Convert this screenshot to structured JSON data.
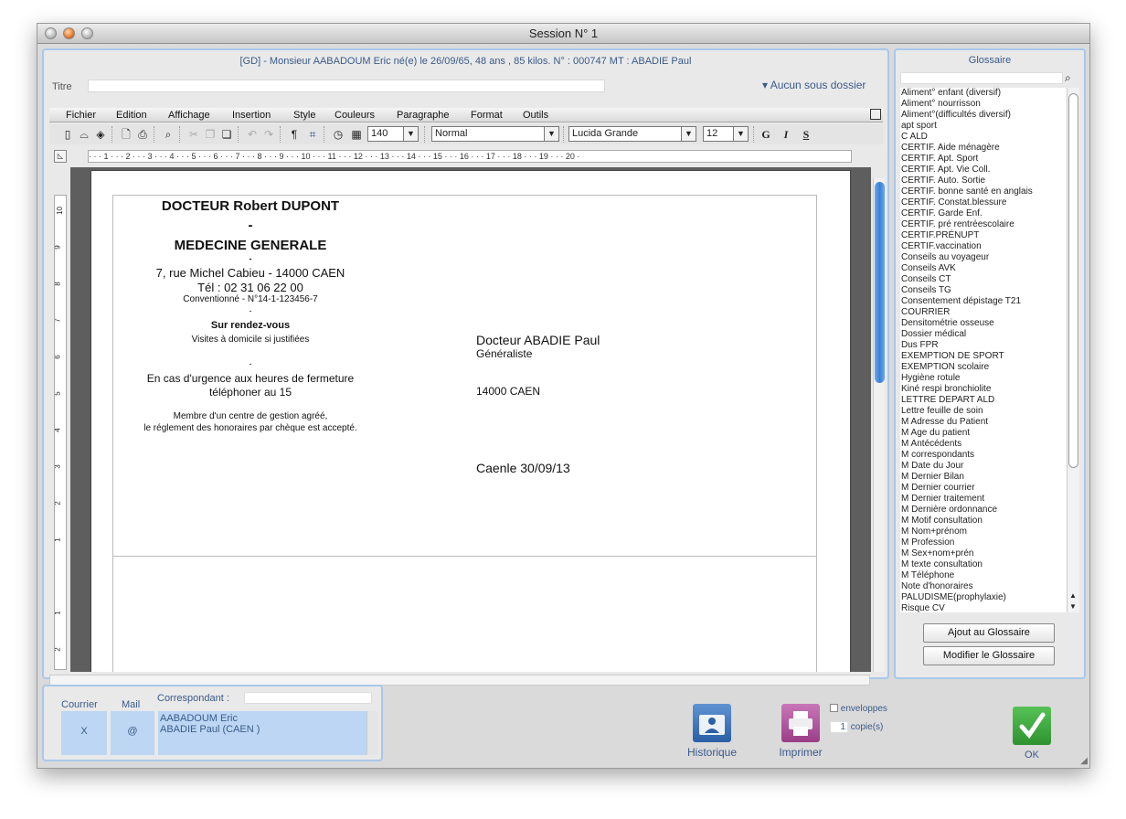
{
  "window": {
    "title": "Session N° 1"
  },
  "patient_header": "[GD] - Monsieur AABADOUM Eric   né(e) le 26/09/65, 48 ans , 85 kilos.  N° : 000747 MT : ABADIE Paul",
  "titre": {
    "label": "Titre",
    "value": ""
  },
  "sous_dossier": "▾ Aucun sous dossier",
  "menu": [
    "Fichier",
    "Edition",
    "Affichage",
    "Insertion",
    "Style",
    "Couleurs",
    "Paragraphe",
    "Format",
    "Outils"
  ],
  "toolbar": {
    "zoom": "140",
    "style": "Normal",
    "font": "Lucida Grande",
    "size": "12",
    "bold": "G",
    "italic": "I",
    "underline": "S"
  },
  "ruler_h": "· · · 1 · · · 2 · · · 3 · · · 4 · · · 5 · · · 6 · · · 7 · · · 8 · · · 9 · · · 10 · · · 11 · · · 12 · · · 13 · · · 14 · · · 15 · · · 16 · · · 17 · · · 18 · · · 19 · · · 20 ·",
  "ruler_v": [
    "10",
    "9",
    "8",
    "7",
    "6",
    "5",
    "4",
    "3",
    "2",
    "1",
    "1",
    "2"
  ],
  "document": {
    "doctor_name": "DOCTEUR Robert DUPONT",
    "dash1": "-",
    "specialty": "MEDECINE GENERALE",
    "dash2": "-",
    "address": "7, rue Michel Cabieu - 14000 CAEN",
    "phone": "Tél : 02 31 06 22 00",
    "convention": "Conventionné - N°14-1-123456-7",
    "dash3": "-",
    "rdv": "Sur rendez-vous",
    "visits": "Visites à domicile si justifiées",
    "dash4": "-",
    "urgence1": "En cas d'urgence aux heures de fermeture",
    "urgence2": "téléphoner au 15",
    "membre1": "Membre d'un centre de gestion  agréé,",
    "membre2": "le réglement des honoraires par chèque est accepté.",
    "recipient_name": "Docteur ABADIE Paul",
    "recipient_role": "Généraliste",
    "recipient_city": "14000 CAEN",
    "date_line": "Caenle 30/09/13"
  },
  "glossaire": {
    "title": "Glossaire",
    "search": "",
    "items": [
      "Aliment° enfant (diversif)",
      "Aliment° nourrisson",
      "Aliment°(difficultés diversif)",
      "apt sport",
      "C ALD",
      "CERTIF. Aide ménagère",
      "CERTIF. Apt. Sport",
      "CERTIF. Apt. Vie Coll.",
      "CERTIF. Auto. Sortie",
      "CERTIF. bonne santé en anglais",
      "CERTIF. Constat.blessure",
      "CERTIF. Garde Enf.",
      "CERTIF. pré rentréescolaire",
      "CERTIF.PRÉNUPT",
      "CERTIF.vaccination",
      "Conseils au voyageur",
      "Conseils AVK",
      "Conseils CT",
      "Conseils TG",
      "Consentement dépistage T21",
      "COURRIER",
      "Densitométrie osseuse",
      "Dossier médical",
      "Dus FPR",
      "EXEMPTION DE SPORT",
      "EXEMPTION scolaire",
      "Hygiène rotule",
      "Kiné respi bronchiolite",
      "LETTRE DEPART ALD",
      "Lettre feuille de soin",
      "M Adresse du Patient",
      "M Age du patient",
      "M Antécédents",
      "M correspondants",
      "M Date du Jour",
      "M Dernier Bilan",
      "M Dernier courrier",
      "M Dernier traitement",
      "M Dernière ordonnance",
      "M Motif consultation",
      "M Nom+prénom",
      "M Profession",
      "M Sex+nom+prén",
      "M texte consultation",
      "M Téléphone",
      "Note d'honoraires",
      "PALUDISME(prophylaxie)",
      "Risque CV"
    ],
    "add_button": "Ajout au Glossaire",
    "modify_button": "Modifier le Glossaire"
  },
  "correspondants": {
    "courrier_label": "Courrier",
    "mail_label": "Mail",
    "corr_label": "Correspondant :",
    "corr_input": "",
    "courrier_value": "X",
    "mail_value": "@",
    "names": [
      "AABADOUM Eric",
      "ABADIE Paul (CAEN )"
    ]
  },
  "actions": {
    "historique": "Historique",
    "imprimer": "Imprimer",
    "enveloppes": "enveloppes",
    "copies_count": "1",
    "copies_label": "copie(s)",
    "ok": "OK"
  },
  "colors": {
    "accent_blue": "#3a5a8a",
    "panel_border": "#a8c8ea",
    "ok_green": "#3aa23a",
    "historique_blue": "#3c6fb2",
    "imprimer_purple": "#b0509a"
  }
}
